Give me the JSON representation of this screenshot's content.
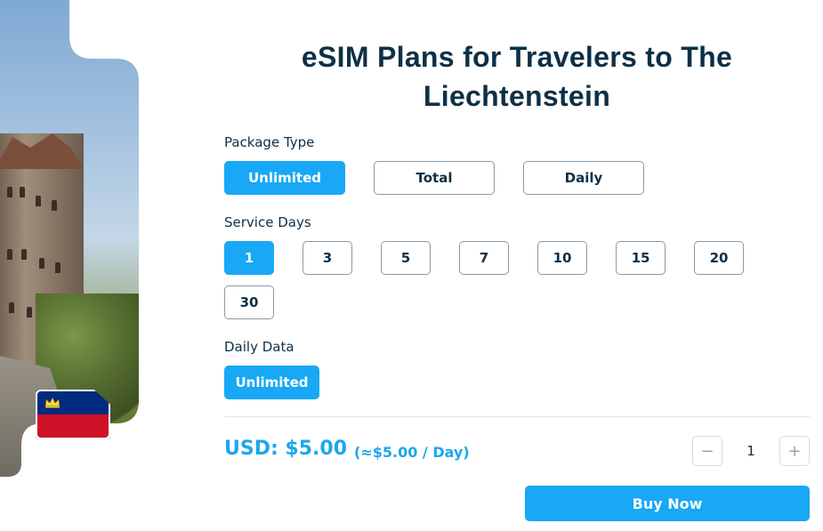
{
  "page": {
    "title": "eSIM Plans for Travelers to The Liechtenstein"
  },
  "hero": {
    "image_icon": "castle-landscape-image",
    "flag_icon": "liechtenstein-flag-icon"
  },
  "package_type": {
    "label": "Package Type",
    "options": [
      "Unlimited",
      "Total",
      "Daily"
    ],
    "selected": "Unlimited"
  },
  "service_days": {
    "label": "Service Days",
    "options": [
      "1",
      "3",
      "5",
      "7",
      "10",
      "15",
      "20",
      "30"
    ],
    "selected": "1"
  },
  "daily_data": {
    "label": "Daily Data",
    "options": [
      "Unlimited"
    ],
    "selected": "Unlimited"
  },
  "pricing": {
    "price": "USD: $5.00",
    "per_day": "(≈$5.00 / Day)"
  },
  "quantity": {
    "minus_label": "−",
    "value": "1",
    "plus_label": "+"
  },
  "actions": {
    "buy_label": "Buy Now"
  },
  "colors": {
    "accent": "#18a8f5",
    "text": "#0e3047",
    "price": "#1ca7ec"
  }
}
